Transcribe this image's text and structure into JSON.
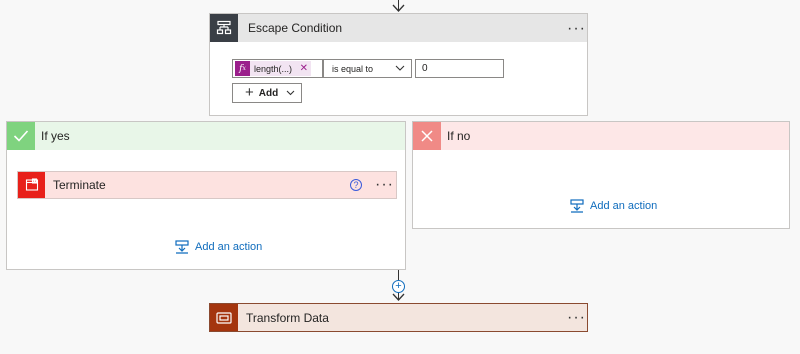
{
  "escape": {
    "title": "Escape Condition",
    "token_label": "length(...)",
    "token_icon": "fx-icon",
    "operator": "is equal to",
    "value": "0",
    "add_label": "Add"
  },
  "yes_branch": {
    "title": "If yes",
    "terminate_title": "Terminate",
    "add_action": "Add an action"
  },
  "no_branch": {
    "title": "If no",
    "add_action": "Add an action"
  },
  "transform": {
    "title": "Transform Data"
  },
  "colors": {
    "condition_header": "#e6e6e6",
    "condition_icon_bg": "#3a3f46",
    "yes_header": "#e8f6e8",
    "yes_icon_bg": "#7fd37f",
    "no_header": "#fde7e7",
    "no_icon_bg": "#f08a86",
    "terminate_header": "#fde2e0",
    "terminate_icon_bg": "#e8201a",
    "transform_header": "#f3e5de",
    "transform_icon_bg": "#a4350e",
    "link": "#0f6cbd"
  }
}
